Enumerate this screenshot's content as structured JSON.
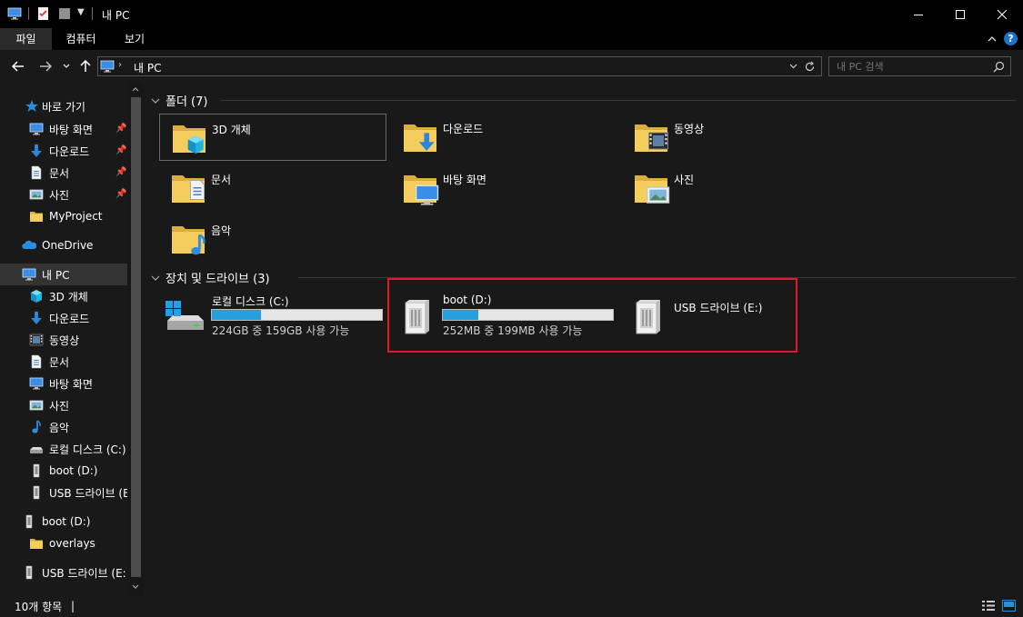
{
  "window": {
    "title": "내 PC",
    "minimize_label": "최소화",
    "maximize_label": "최대화",
    "close_label": "닫기"
  },
  "ribbon": {
    "tabs": [
      {
        "label": "파일"
      },
      {
        "label": "컴퓨터"
      },
      {
        "label": "보기"
      }
    ]
  },
  "address": {
    "path": "내 PC",
    "search_placeholder": "내 PC 검색"
  },
  "sidebar": {
    "quick_access": {
      "label": "바로 가기"
    },
    "quick_items": [
      {
        "label": "바탕 화면",
        "icon": "desktop-icon",
        "pinned": true
      },
      {
        "label": "다운로드",
        "icon": "download-icon",
        "pinned": true
      },
      {
        "label": "문서",
        "icon": "document-icon",
        "pinned": true
      },
      {
        "label": "사진",
        "icon": "picture-icon",
        "pinned": true
      },
      {
        "label": "MyProject",
        "icon": "folder-icon",
        "pinned": false
      }
    ],
    "onedrive": {
      "label": "OneDrive"
    },
    "thispc": {
      "label": "내 PC"
    },
    "pc_items": [
      {
        "label": "3D 개체",
        "icon": "3d-objects-icon"
      },
      {
        "label": "다운로드",
        "icon": "download-icon"
      },
      {
        "label": "동영상",
        "icon": "video-icon"
      },
      {
        "label": "문서",
        "icon": "document-icon"
      },
      {
        "label": "바탕 화면",
        "icon": "desktop-icon"
      },
      {
        "label": "사진",
        "icon": "picture-icon"
      },
      {
        "label": "음악",
        "icon": "music-icon"
      },
      {
        "label": "로컬 디스크 (C:)",
        "icon": "local-disk-icon"
      },
      {
        "label": "boot (D:)",
        "icon": "removable-drive-icon"
      },
      {
        "label": "USB 드라이브 (E:)",
        "icon": "removable-drive-icon"
      }
    ],
    "boot_drive": {
      "label": "boot (D:)"
    },
    "overlays": {
      "label": "overlays"
    },
    "usb_drive": {
      "label": "USB 드라이브 (E:)"
    }
  },
  "content": {
    "folders_header": "폴더 (7)",
    "folders": [
      {
        "label": "3D 개체",
        "icon": "3d-objects-folder-icon"
      },
      {
        "label": "다운로드",
        "icon": "downloads-folder-icon"
      },
      {
        "label": "동영상",
        "icon": "videos-folder-icon"
      },
      {
        "label": "문서",
        "icon": "documents-folder-icon"
      },
      {
        "label": "바탕 화면",
        "icon": "desktop-folder-icon"
      },
      {
        "label": "사진",
        "icon": "pictures-folder-icon"
      },
      {
        "label": "음악",
        "icon": "music-folder-icon"
      }
    ],
    "drives_header": "장치 및 드라이브 (3)",
    "drives": [
      {
        "label": "로컬 디스크 (C:)",
        "sub": "224GB 중 159GB 사용 가능",
        "used_fraction": 0.29,
        "icon": "windows-drive-icon"
      },
      {
        "label": "boot (D:)",
        "sub": "252MB 중 199MB 사용 가능",
        "used_fraction": 0.21,
        "icon": "removable-drive-icon"
      },
      {
        "label": "USB 드라이브 (E:)",
        "sub": "",
        "used_fraction": null,
        "icon": "removable-drive-icon"
      }
    ]
  },
  "statusbar": {
    "item_count": "10개 항목",
    "separator": "|"
  },
  "colors": {
    "background": "#191919",
    "accent_bar": "#26a0da",
    "highlight_box": "#e0192a",
    "folder_yellow": "#f0c550"
  }
}
